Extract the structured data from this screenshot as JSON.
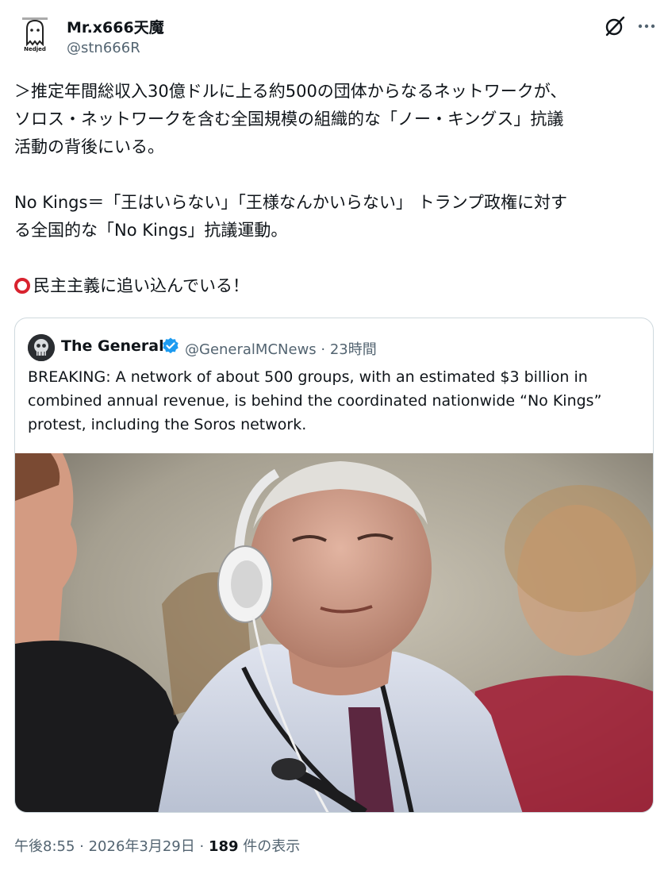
{
  "author": {
    "name": "Mr.x666天魔",
    "handle": "@stn666R",
    "avatar_caption": "Nedjed"
  },
  "icons": {
    "grok": "grok-icon",
    "more": "more-options-icon",
    "red_circle": "red-circle-emoji"
  },
  "post": {
    "lines_1": [
      "＞推定年間総収入30億ドルに上る約500の団体からなるネットワークが、",
      "ソロス・ネットワークを含む全国規模の組織的な「ノー・キングス」抗議",
      "活動の背後にいる。"
    ],
    "lines_2": [
      "No Kings＝「王はいらない」「王様なんかいらない」 トランプ政権に対す",
      "る全国的な「No Kings」抗議運動。"
    ],
    "line_3": "民主主義に追い込んでいる！"
  },
  "quote": {
    "name": "The General",
    "handle": "@GeneralMCNews",
    "time": "23時間",
    "verified_color": "#1d9bf0",
    "lines": [
      "BREAKING: A network of about 500 groups, with an estimated $3 billion in",
      "combined annual revenue, is behind the coordinated nationwide “No Kings”",
      "protest, including the Soros network."
    ]
  },
  "footer": {
    "time": "午後8:55",
    "date": "2026年3月29日",
    "views_count": "189",
    "views_label": "件の表示"
  },
  "colors": {
    "text": "#0f1419",
    "secondary": "#536471",
    "border": "#cfd9de",
    "emoji_red": "#d8222e"
  }
}
